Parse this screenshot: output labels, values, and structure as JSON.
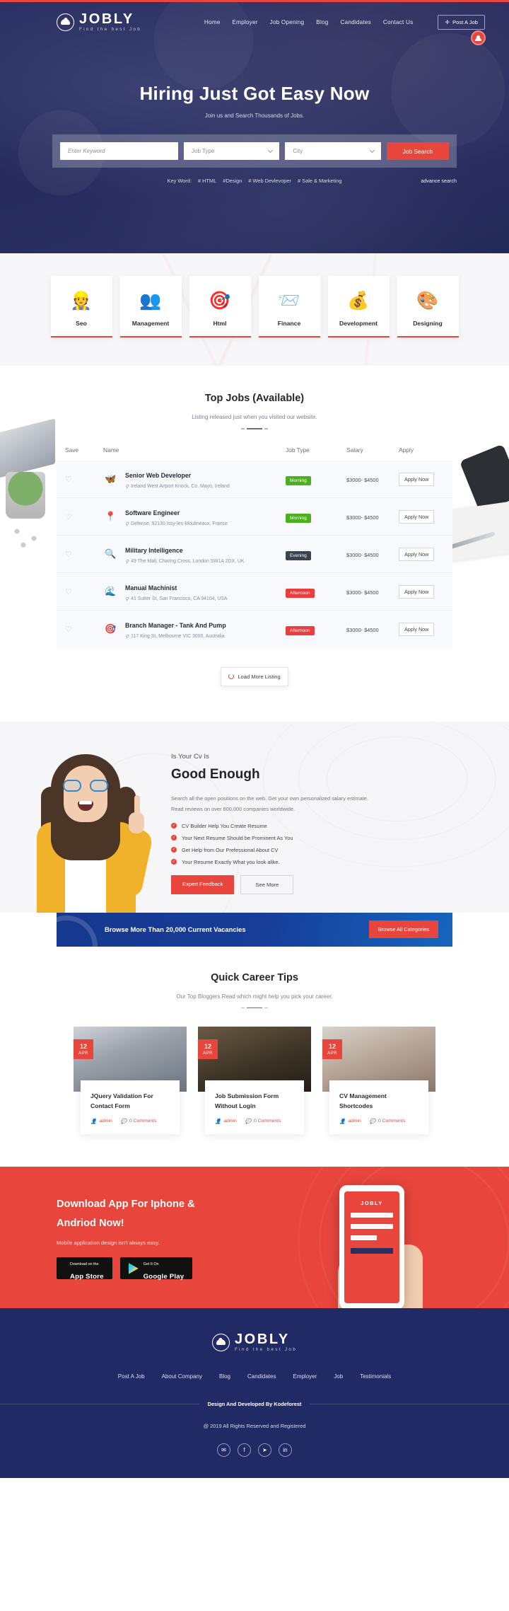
{
  "brand": {
    "name": "JOBLY",
    "tagline": "Find the best Job",
    "logo_icon": "people-circle-icon"
  },
  "nav": {
    "links": [
      {
        "label": "Home"
      },
      {
        "label": "Employer"
      },
      {
        "label": "Job Opening"
      },
      {
        "label": "Blog"
      },
      {
        "label": "Candidates"
      },
      {
        "label": "Contact Us"
      }
    ],
    "post_job_label": "Post A Job",
    "post_job_icon": "plus-icon",
    "account_icon": "user-avatar-icon"
  },
  "hero": {
    "title": "Hiring Just Got Easy Now",
    "subtitle": "Join us and Search Thousands of Jobs.",
    "search": {
      "keyword_placeholder": "Enter Keyword",
      "job_type_value": "Job Type",
      "city_value": "City",
      "button_label": "Job Search",
      "chevron_icon": "chevron-down-icon"
    },
    "keywords_label": "Key Word:",
    "keywords": [
      "# HTML",
      "#Design",
      "# Web Devlevoper",
      "# Sale & Marketing"
    ],
    "advance_search_label": "advance search"
  },
  "categories": [
    {
      "label": "Seo",
      "icon": "worker-laptop-icon",
      "glyph": "👷"
    },
    {
      "label": "Management",
      "icon": "team-network-icon",
      "glyph": "👥"
    },
    {
      "label": "Html",
      "icon": "target-dart-icon",
      "glyph": "🎯"
    },
    {
      "label": "Finance",
      "icon": "envelope-chart-icon",
      "glyph": "📨"
    },
    {
      "label": "Development",
      "icon": "money-bag-icon",
      "glyph": "💰"
    },
    {
      "label": "Designing",
      "icon": "paint-palette-icon",
      "glyph": "🎨"
    }
  ],
  "top_jobs": {
    "title": "Top Jobs (Available)",
    "subtitle": "Listing released just when you visited our website.",
    "columns": {
      "save": "Save",
      "name": "Name",
      "job_type": "Job Type",
      "salary": "Salary",
      "apply": "Apply"
    },
    "save_icon": "heart-outline-icon",
    "location_icon": "map-pin-icon",
    "rows": [
      {
        "name": "Senior Web Developer",
        "location": "Ireland West Airport Knock, Co. Mayo, Ireland",
        "type": "Morning",
        "type_color": "#4caf1d",
        "salary": "$3000- $4500",
        "apply_label": "Apply Now",
        "logo_glyph": "🦋",
        "logo_color": "#f0623a"
      },
      {
        "name": "Software Engineer",
        "location": "Defense, 92130 Issy-les-Moulineaux, France",
        "type": "Morning",
        "type_color": "#4caf1d",
        "salary": "$3000- $4500",
        "apply_label": "Apply Now",
        "logo_glyph": "📍",
        "logo_color": "#e0325b"
      },
      {
        "name": "Military Intelligence",
        "location": "49 The Mall, Charing Cross, London SW1A 2DX, UK",
        "type": "Evening",
        "type_color": "#3c4250",
        "salary": "$3000- $4500",
        "apply_label": "Apply Now",
        "logo_glyph": "🔍",
        "logo_color": "#e8453c"
      },
      {
        "name": "Manual Machinist",
        "location": "41 Sutter St, San Francisco, CA 94104, USA",
        "type": "Afternoon",
        "type_color": "#ec3c3c",
        "salary": "$3000- $4500",
        "apply_label": "Apply Now",
        "logo_glyph": "🌊",
        "logo_color": "#1f6fb2"
      },
      {
        "name": "Branch Manager - Tank And Pump",
        "location": "117 King St, Melbourne VIC 3000, Australia",
        "type": "Afternoon",
        "type_color": "#ec3c3c",
        "salary": "$3000- $4500",
        "apply_label": "Apply Now",
        "logo_glyph": "🎯",
        "logo_color": "#d93a3a"
      }
    ],
    "load_more_label": "Load More Listing",
    "load_more_icon": "spinner-icon"
  },
  "cv": {
    "eyebrow": "Is Your Cv Is",
    "heading": "Good Enough",
    "description": "Search all the open positions on the web. Get your own personalized salary estimate. Read reviews on over 600,000 companies worldwide.",
    "bullets": [
      "CV Builder Help You Create Resume",
      "Your Next Resume Should be Prominent As You",
      "Get Help from Our Prefessional About CV",
      "Your Resume Exactly What you look alike."
    ],
    "bullet_icon": "check-circle-icon",
    "primary_button": "Expert Feedback",
    "secondary_button": "See More"
  },
  "banner": {
    "text": "Browse More Than 20,000 Current Vacancies",
    "button_label": "Browse All Categories"
  },
  "tips": {
    "title": "Quick Career Tips",
    "subtitle": "Our Top Bloggers Read which might help you pick your career.",
    "author_icon": "user-icon",
    "comment_icon": "comment-bubble-icon",
    "posts": [
      {
        "day": "12",
        "month": "APR",
        "title": "JQuery Validation For Contact Form",
        "author": "admin",
        "comments": "0 Comments"
      },
      {
        "day": "12",
        "month": "APR",
        "title": "Job Submission Form Without Login",
        "author": "admin",
        "comments": "0 Comments"
      },
      {
        "day": "12",
        "month": "APR",
        "title": "CV Management Shortcodes",
        "author": "admin",
        "comments": "0 Comments"
      }
    ]
  },
  "app": {
    "title_line1": "Download App For Iphone &",
    "title_line2": "Andriod Now!",
    "subtitle": "Mobile application design isn't always easy.",
    "appstore": {
      "small": "Download on the",
      "big": "App Store",
      "icon": "apple-icon"
    },
    "googleplay": {
      "small": "Get It On",
      "big": "Google Play",
      "icon": "google-play-icon"
    },
    "phone_brand": "JOBLY"
  },
  "footer": {
    "brand_name": "JOBLY",
    "brand_tagline": "Find the best Job",
    "links": [
      {
        "label": "Post A Job"
      },
      {
        "label": "About Company"
      },
      {
        "label": "Blog"
      },
      {
        "label": "Candidates"
      },
      {
        "label": "Employer"
      },
      {
        "label": "Job"
      },
      {
        "label": "Testimonials"
      }
    ],
    "credit": "Design And Developed By Kodeforest",
    "copyright": "@ 2019 All Rights Reserved and Registered",
    "socials": [
      {
        "name": "email-icon",
        "glyph": "✉"
      },
      {
        "name": "facebook-icon",
        "glyph": "f"
      },
      {
        "name": "twitter-icon",
        "glyph": "➤"
      },
      {
        "name": "linkedin-icon",
        "glyph": "in"
      }
    ]
  },
  "colors": {
    "accent": "#e8453c",
    "navy": "#222a66",
    "blue": "#16388f",
    "green": "#4caf1d"
  }
}
